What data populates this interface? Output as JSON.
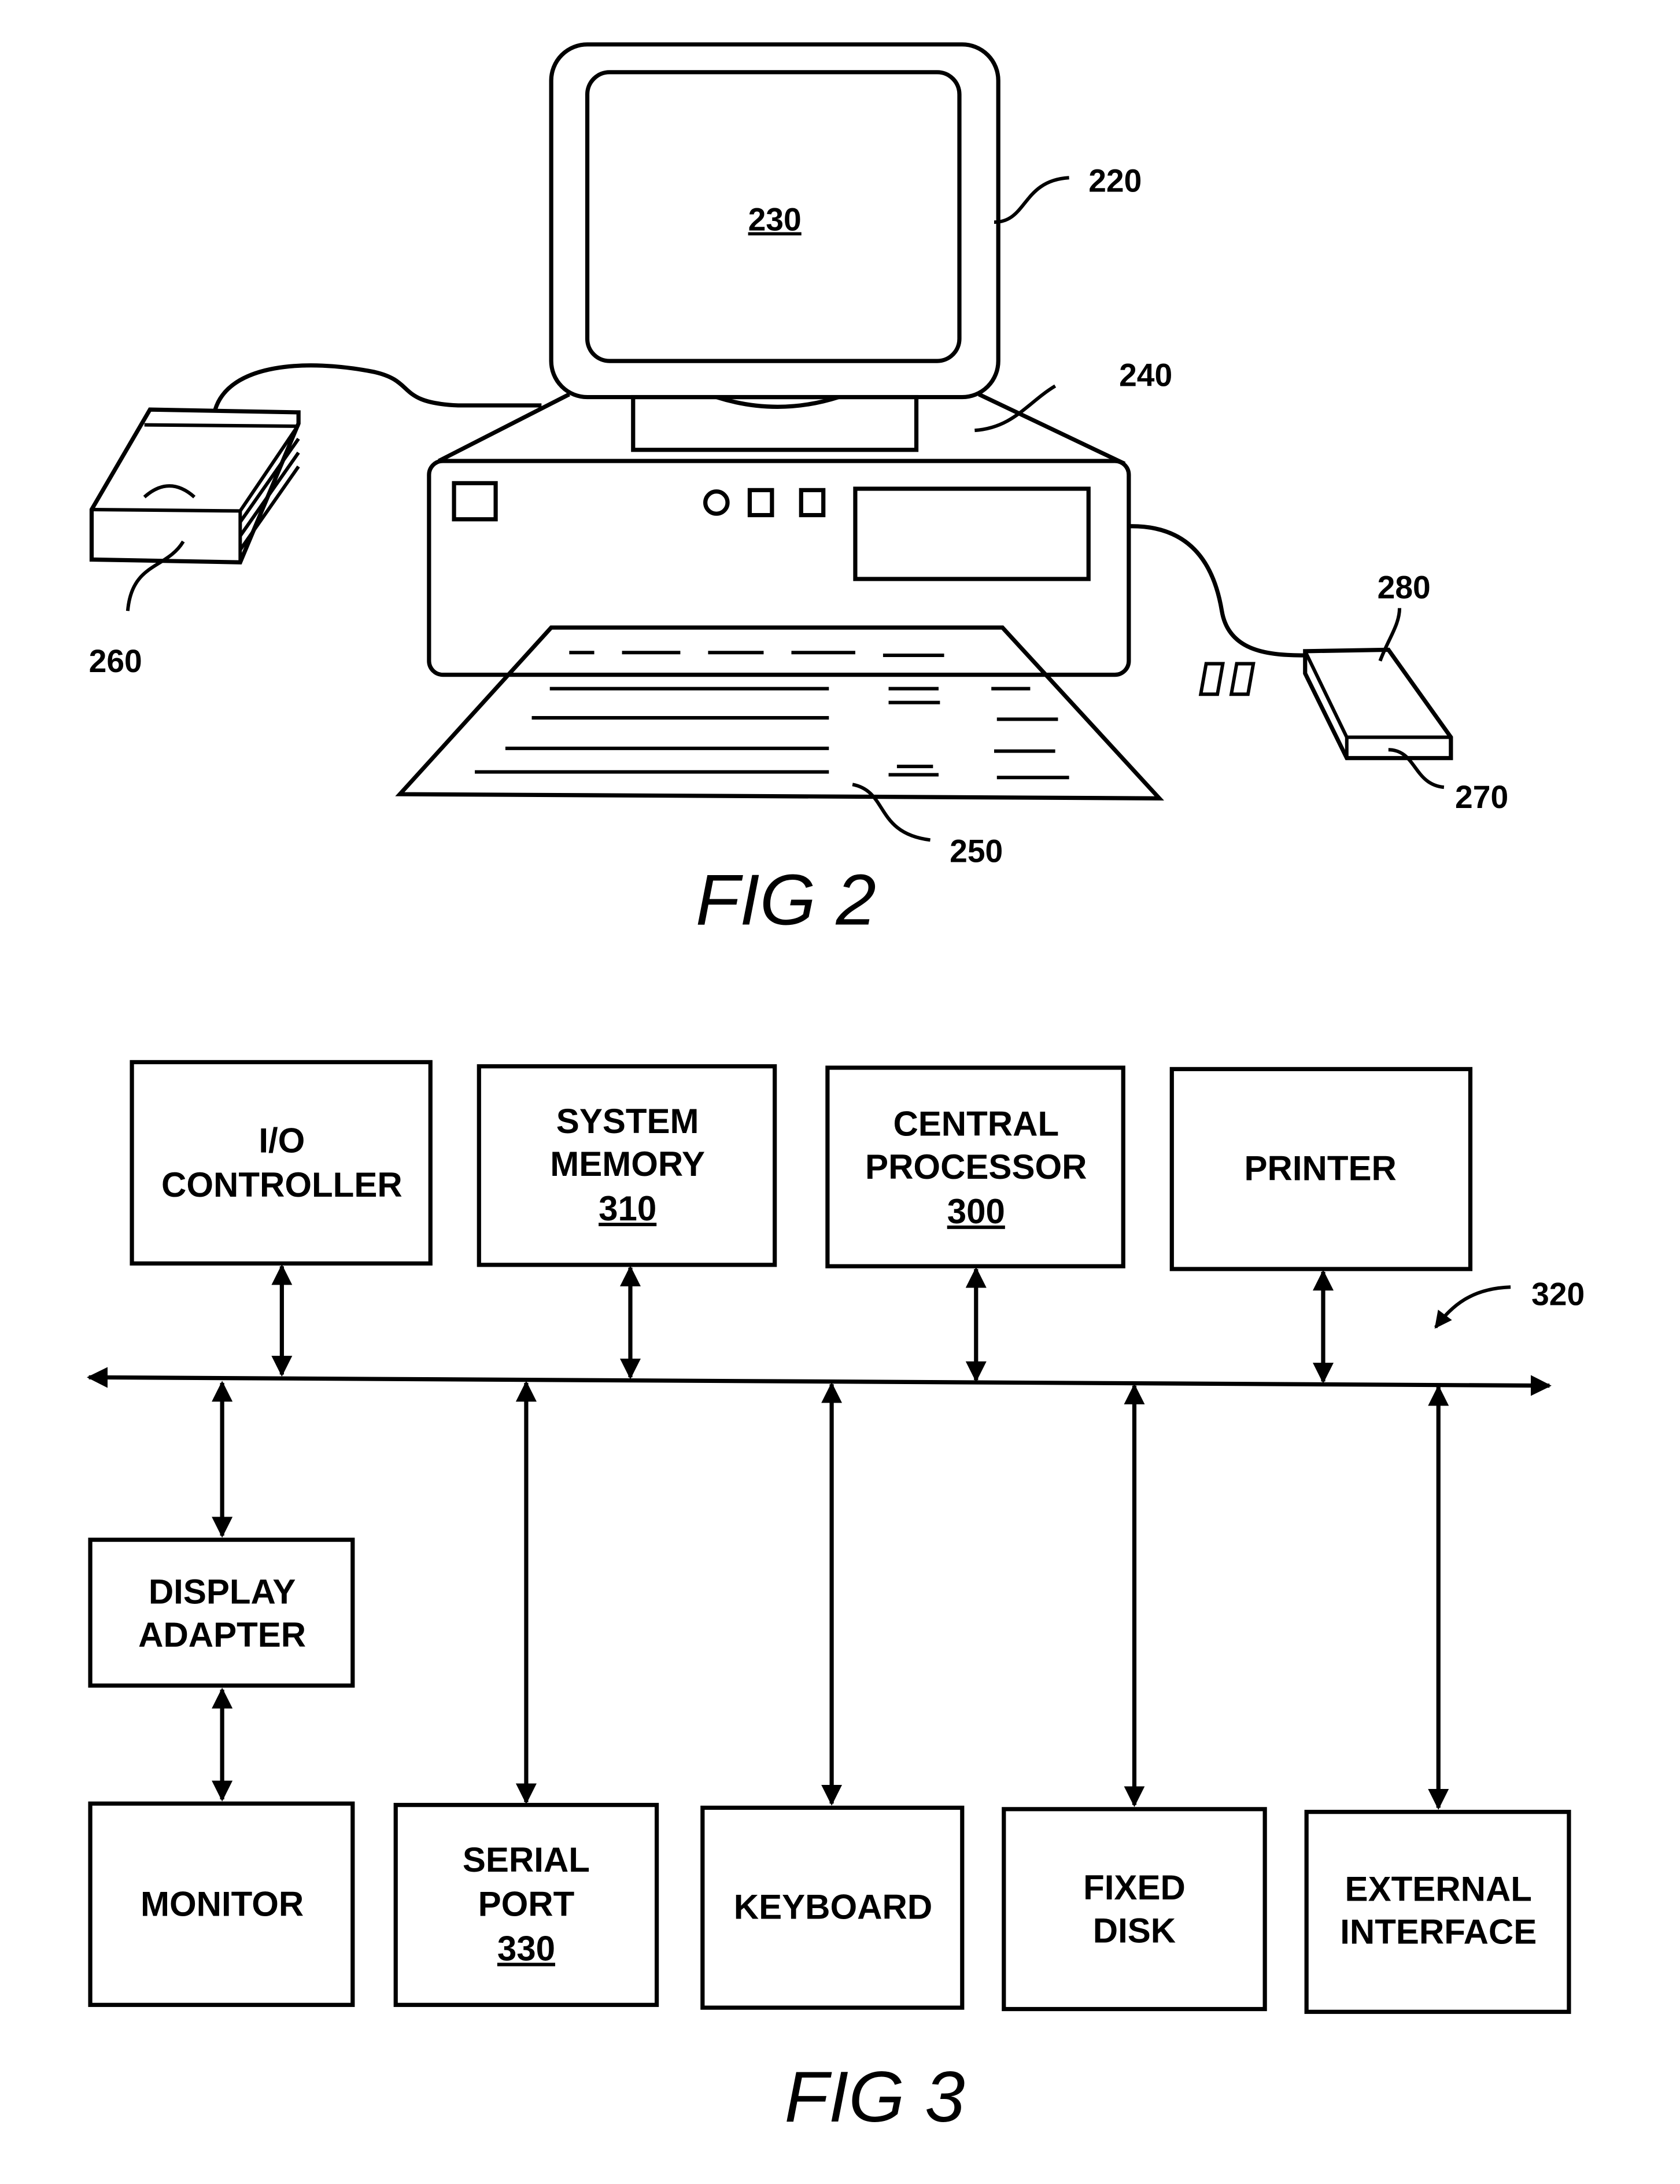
{
  "fig2": {
    "caption": "FIG 2",
    "refs": {
      "monitor": "220",
      "screen": "230",
      "computer_unit": "240",
      "keyboard": "250",
      "disk_drive": "260",
      "mouse": "270",
      "mouse_button": "280"
    }
  },
  "fig3": {
    "caption": "FIG 3",
    "bus_ref": "320",
    "top_row": [
      {
        "lines": [
          "I/O",
          "CONTROLLER"
        ],
        "ref": ""
      },
      {
        "lines": [
          "SYSTEM",
          "MEMORY"
        ],
        "ref": "310"
      },
      {
        "lines": [
          "CENTRAL",
          "PROCESSOR"
        ],
        "ref": "300"
      },
      {
        "lines": [
          "PRINTER"
        ],
        "ref": ""
      }
    ],
    "middle": {
      "lines": [
        "DISPLAY",
        "ADAPTER"
      ],
      "ref": ""
    },
    "bottom_row": [
      {
        "lines": [
          "MONITOR"
        ],
        "ref": ""
      },
      {
        "lines": [
          "SERIAL",
          "PORT"
        ],
        "ref": "330"
      },
      {
        "lines": [
          "KEYBOARD"
        ],
        "ref": ""
      },
      {
        "lines": [
          "FIXED",
          "DISK"
        ],
        "ref": ""
      },
      {
        "lines": [
          "EXTERNAL",
          "INTERFACE"
        ],
        "ref": ""
      }
    ]
  }
}
